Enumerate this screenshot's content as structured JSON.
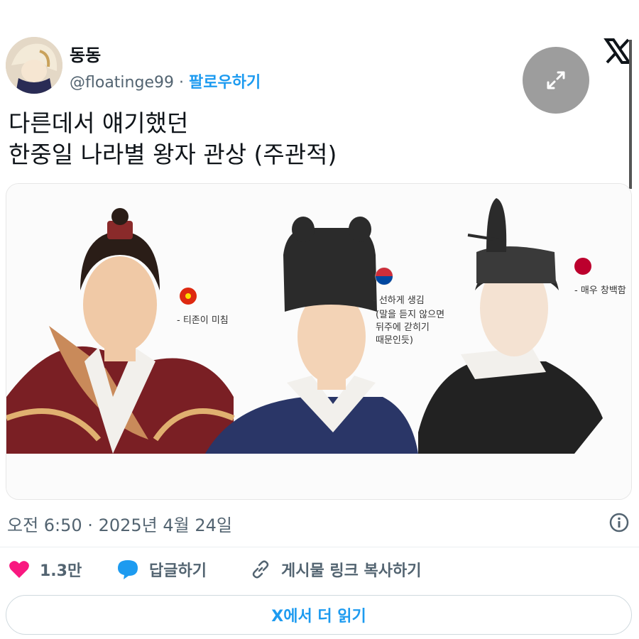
{
  "author": {
    "display_name": "동동",
    "handle": "@floatinge99",
    "separator": "·",
    "follow_label": "팔로우하기"
  },
  "tweet": {
    "lines": [
      "다른데서 얘기했던",
      "한중일 나라별 왕자 관상 (주관적)"
    ],
    "timestamp": "오전 6:50 · 2025년 4월 24일"
  },
  "media": {
    "annotations": {
      "china": "- 티존이 미침",
      "korea_1": "- 선하게 생김",
      "korea_2": "(말을 듣지 않으면",
      "korea_3": "뒤주에 갇히기",
      "korea_4": "때문인듯)",
      "japan": "- 매우 창백함"
    }
  },
  "actions": {
    "like_count": "1.3만",
    "reply_label": "답글하기",
    "copy_link_label": "게시물 링크 복사하기"
  },
  "read_more_label": "X에서 더 읽기",
  "colors": {
    "follow_blue": "#1d9bf0",
    "like_pink": "#f91880",
    "reply_blue": "#1d9bf0",
    "muted_text": "#536471"
  },
  "icons": [
    "avatar",
    "x-logo-icon",
    "expand-icon",
    "info-icon",
    "heart-icon",
    "speech-bubble-icon",
    "link-icon"
  ]
}
